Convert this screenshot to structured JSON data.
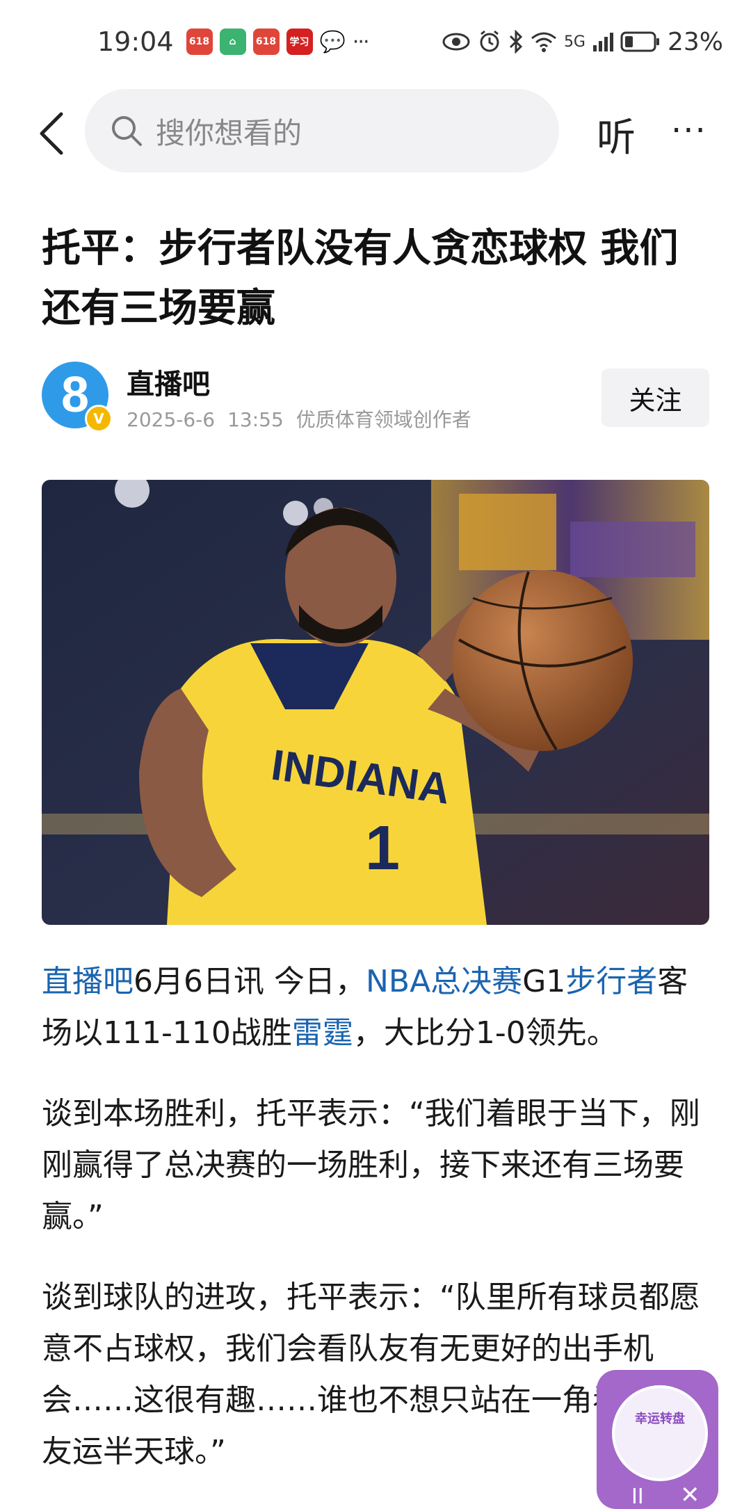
{
  "status_bar": {
    "time": "19:04",
    "badges": [
      {
        "label": "618",
        "color": "#e0453a"
      },
      {
        "label": "⌂",
        "color": "#3cb371"
      },
      {
        "label": "618",
        "color": "#e0453a"
      },
      {
        "label": "学习",
        "color": "#d42020"
      }
    ],
    "network": "5G",
    "battery": "23%"
  },
  "nav": {
    "search_placeholder": "搜你想看的",
    "listen_label": "听",
    "more_label": "···"
  },
  "article": {
    "title": "托平：步行者队没有人贪恋球权 我们还有三场要赢",
    "author": {
      "name": "直播吧",
      "avatar_text": "8",
      "verified": "V",
      "date": "2025-6-6",
      "time": "13:55",
      "description": "优质体育领域创作者"
    },
    "follow_label": "关注",
    "p1": {
      "source": "直播吧",
      "dateline": "6月6日讯 今日，",
      "event": "NBA总决赛",
      "game": "G1",
      "team1": "步行者",
      "mid": "客场以111-110战胜",
      "team2": "雷霆",
      "end": "，大比分1-0领先。"
    },
    "p2": "谈到本场胜利，托平表示：“我们着眼于当下，刚刚赢得了总决赛的一场胜利，接下来还有三场要赢。”",
    "p3": "谈到球队的进攻，托平表示：“队里所有球员都愿意不占球权，我们会看队友有无更好的出手机会……这很有趣……谁也不想只站在一角看着队友运半天球。”"
  },
  "hero": {
    "jersey_text": "INDIANA",
    "jersey_number": "1"
  },
  "float_widget": {
    "label": "幸运转盘",
    "pause": "II",
    "close": "✕"
  },
  "colors": {
    "link": "#1a64b0",
    "brand_blue": "#2f9be8",
    "jersey_yellow": "#f7d53a",
    "jersey_navy": "#1b2a5a",
    "widget_purple": "#a368c9"
  }
}
